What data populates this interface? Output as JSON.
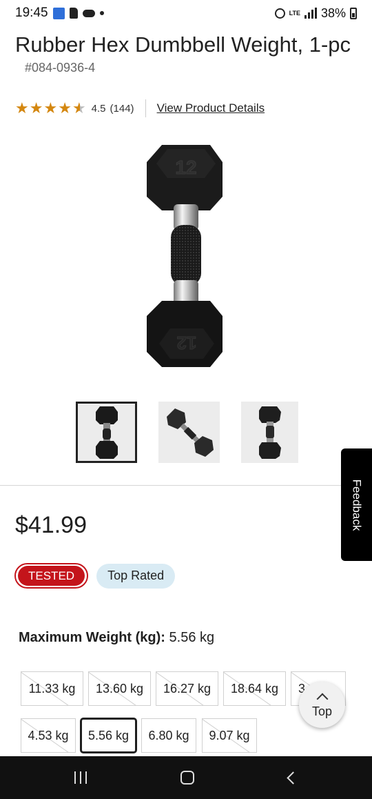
{
  "status_bar": {
    "time": "19:45",
    "lte": "LTE",
    "battery": "38%"
  },
  "product": {
    "title": "Rubber Hex Dumbbell Weight, 1-pc",
    "sku": "#084-0936-4",
    "rating": 4.5,
    "rating_label": "4.5",
    "review_count": "(144)",
    "details_link": "View Product Details"
  },
  "thumbnails": [
    {
      "name": "thumb-front",
      "selected": true
    },
    {
      "name": "thumb-angled",
      "selected": false
    },
    {
      "name": "thumb-side",
      "selected": false
    }
  ],
  "price": "$41.99",
  "badges": {
    "tested": "TESTED",
    "top_rated": "Top Rated"
  },
  "weight": {
    "label": "Maximum Weight (kg):",
    "selected_value": "5.56 kg",
    "options": [
      {
        "label": "11.33 kg",
        "available": false,
        "selected": false
      },
      {
        "label": "13.60 kg",
        "available": false,
        "selected": false
      },
      {
        "label": "16.27 kg",
        "available": false,
        "selected": false
      },
      {
        "label": "18.64 kg",
        "available": false,
        "selected": false
      },
      {
        "label": "3",
        "available": false,
        "selected": false
      },
      {
        "label": "4.53 kg",
        "available": false,
        "selected": false
      },
      {
        "label": "5.56 kg",
        "available": true,
        "selected": true
      },
      {
        "label": "6.80 kg",
        "available": true,
        "selected": false
      },
      {
        "label": "9.07 kg",
        "available": false,
        "selected": false
      }
    ]
  },
  "feedback_label": "Feedback",
  "top_button_label": "Top",
  "icons": {
    "star": "star-icon",
    "chevron": "chevron-up-icon",
    "dumbbell": "dumbbell-image"
  },
  "colors": {
    "accent_red": "#c4141b",
    "badge_blue": "#d9ebf4",
    "star": "#d4870f"
  }
}
